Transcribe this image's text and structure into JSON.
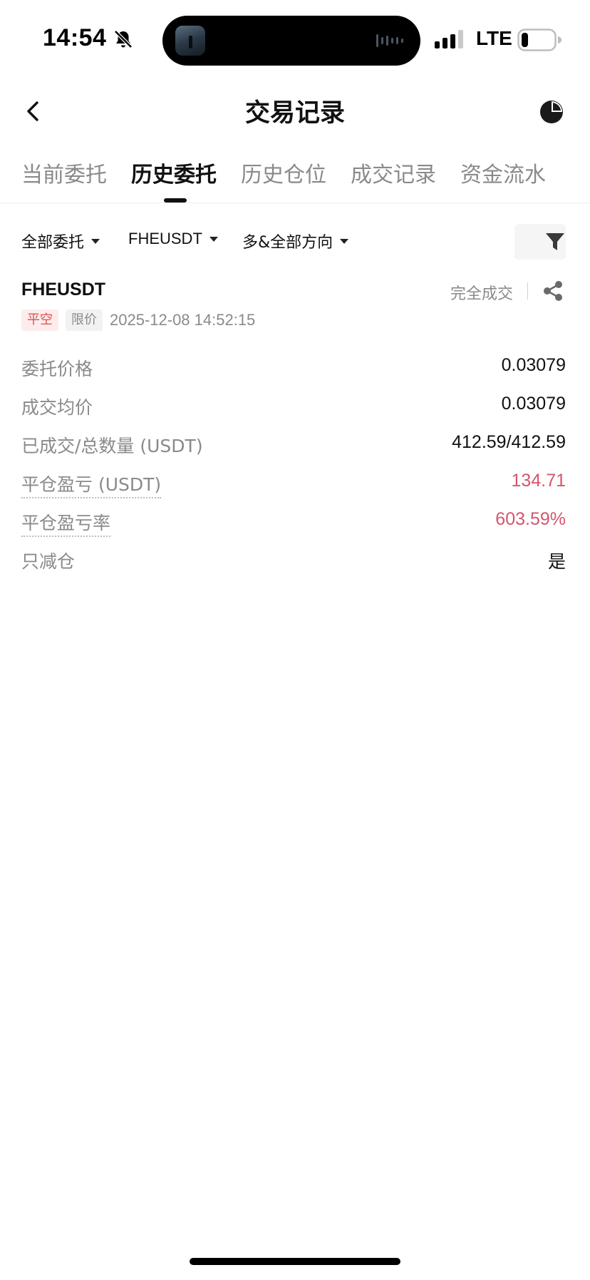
{
  "status_bar": {
    "time": "14:54",
    "network": "LTE",
    "icons": [
      "bell-slash-icon",
      "signal-icon",
      "battery-icon"
    ]
  },
  "header": {
    "title": "交易记录",
    "left_icon": "chevron-left-icon",
    "right_icon": "pie-chart-icon"
  },
  "tabs": [
    {
      "label": "当前委托",
      "active": false
    },
    {
      "label": "历史委托",
      "active": true
    },
    {
      "label": "历史仓位",
      "active": false
    },
    {
      "label": "成交记录",
      "active": false
    },
    {
      "label": "资金流水",
      "active": false
    }
  ],
  "filters": {
    "order_type": "全部委托",
    "symbol": "FHEUSDT",
    "direction": "多&全部方向",
    "filter_icon": "funnel-icon"
  },
  "order": {
    "symbol": "FHEUSDT",
    "status": "完全成交",
    "side_badge": "平空",
    "type_badge": "限价",
    "time": "2025-12-08 14:52:15",
    "rows": [
      {
        "label": "委托价格",
        "value": "0.03079"
      },
      {
        "label": "成交均价",
        "value": "0.03079"
      },
      {
        "label": "已成交/总数量 (USDT)",
        "value": "412.59/412.59"
      },
      {
        "label": "平仓盈亏 (USDT)",
        "value": "134.71"
      },
      {
        "label": "平仓盈亏率",
        "value": "603.59%"
      },
      {
        "label": "只减仓",
        "value": "是"
      }
    ]
  },
  "colors": {
    "accent_text": "#111111",
    "muted_text": "#8a8a8a",
    "pnl": "#d4566a",
    "badge_red_bg": "#fdecec",
    "badge_red_text": "#d9534f"
  }
}
